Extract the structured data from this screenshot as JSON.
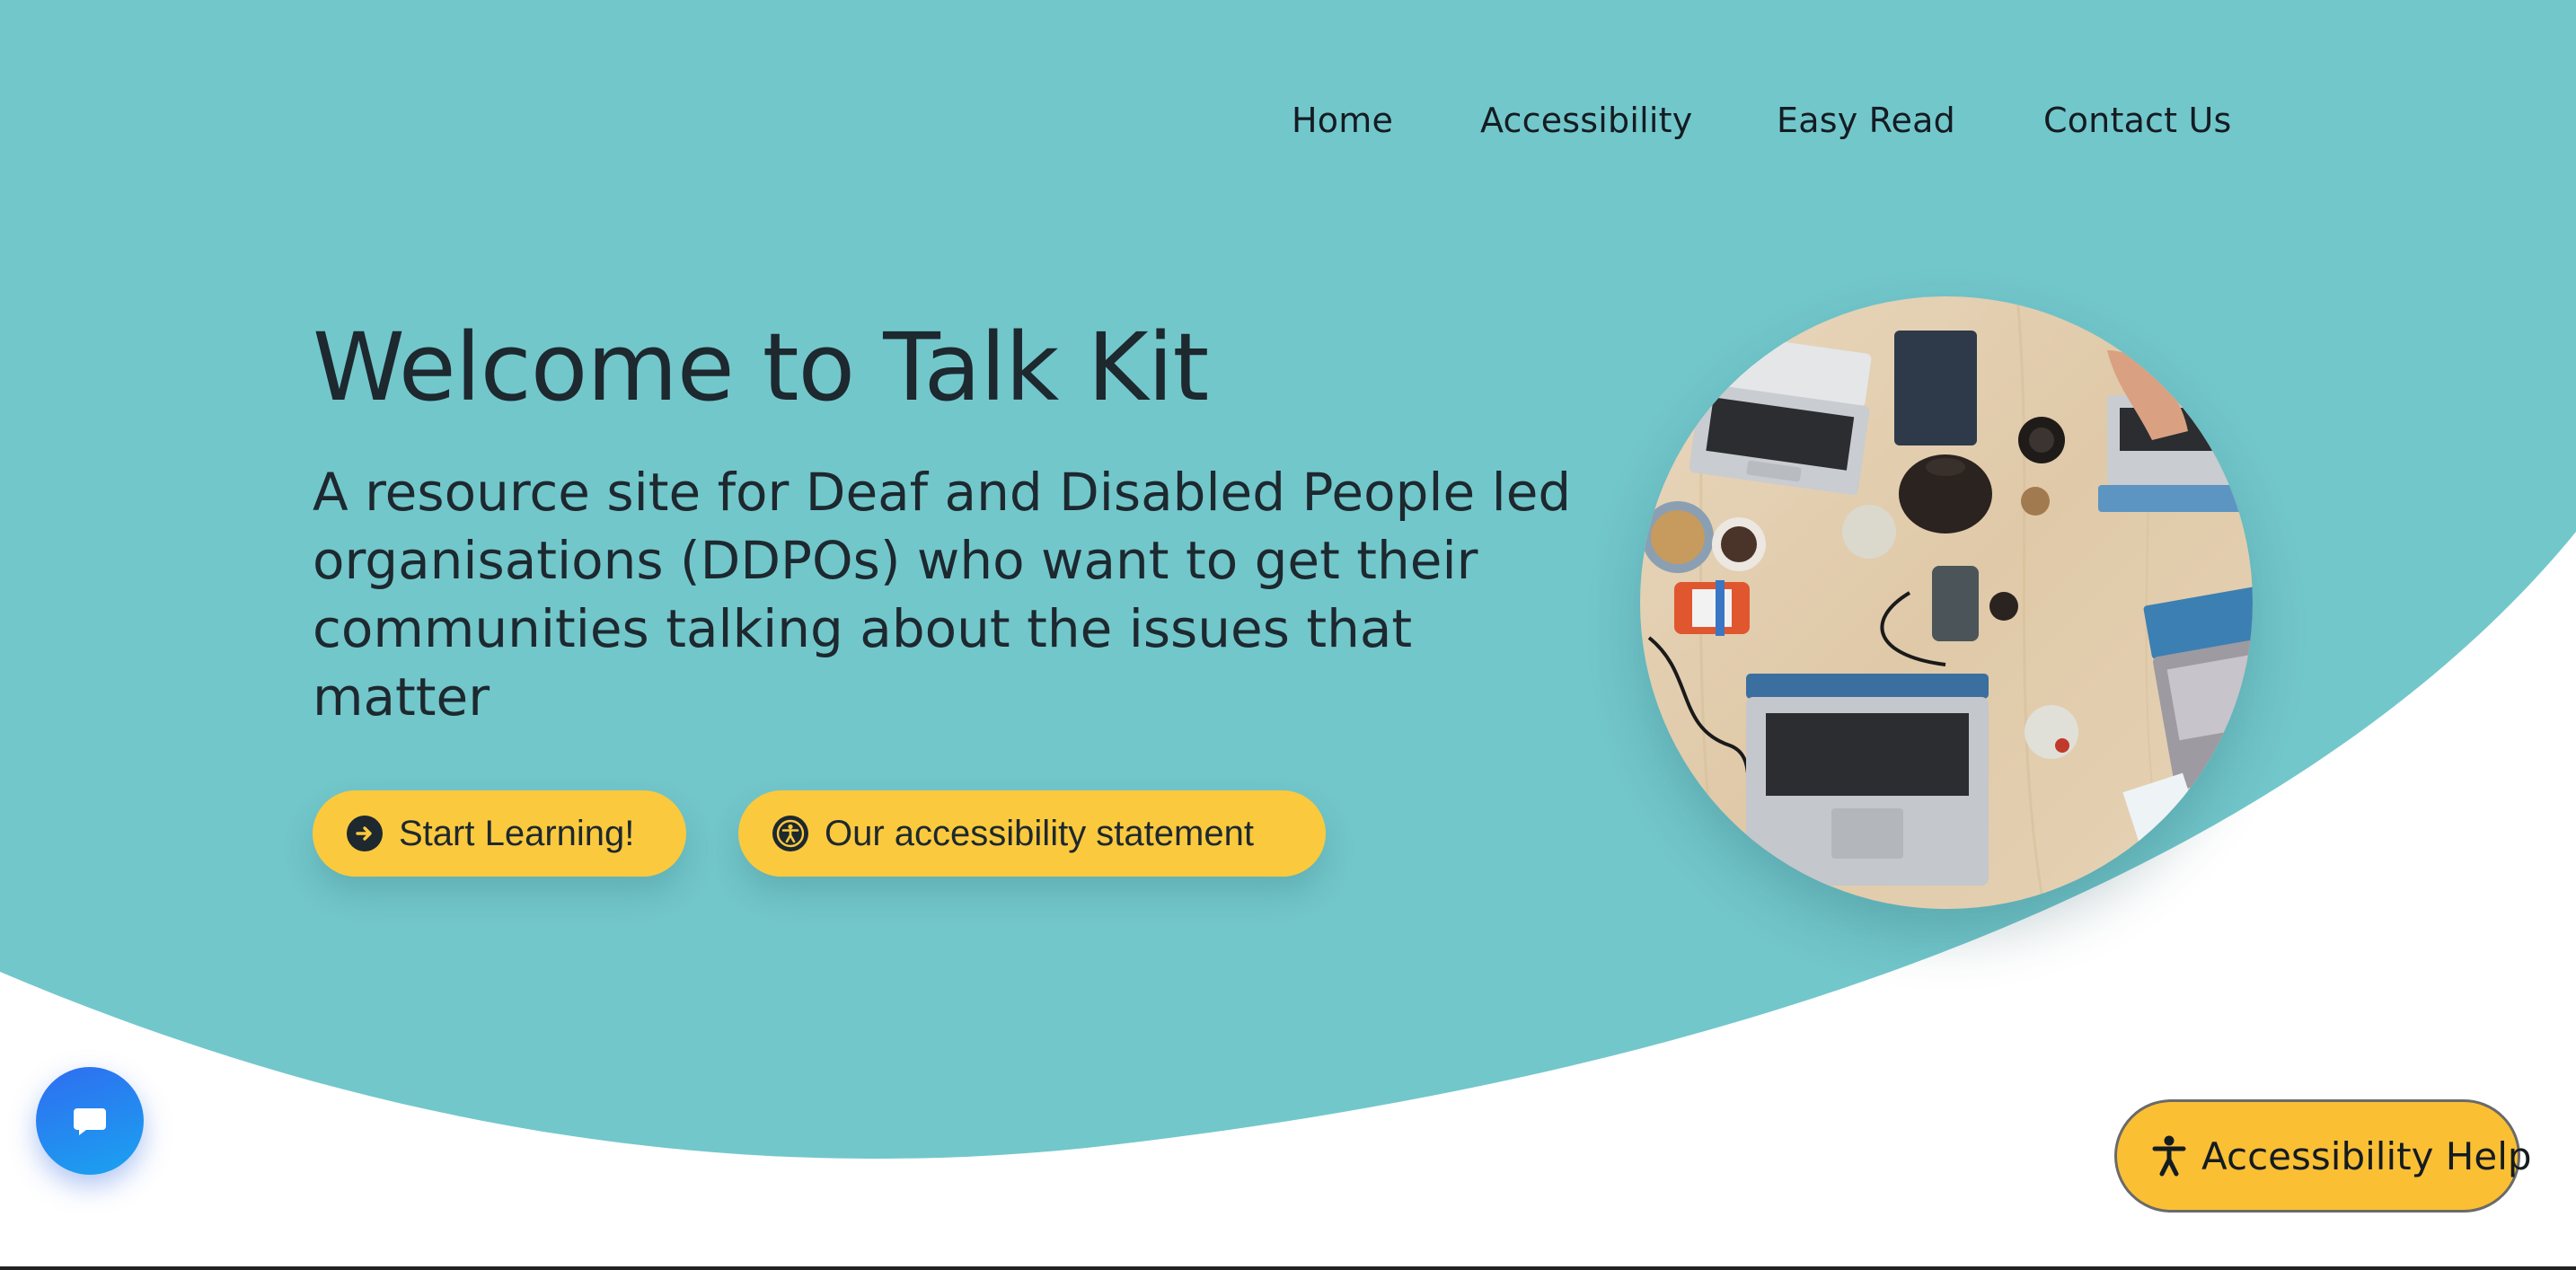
{
  "colors": {
    "hero_background": "#72c7cb",
    "button_yellow": "#fbc93d",
    "help_yellow": "#fbbf34",
    "text_dark": "#1d282f",
    "chat_blue": "#2f6df0"
  },
  "nav": {
    "items": [
      {
        "label": "Home"
      },
      {
        "label": "Accessibility"
      },
      {
        "label": "Easy Read"
      },
      {
        "label": "Contact Us"
      }
    ]
  },
  "hero": {
    "title": "Welcome to Talk Kit",
    "subtitle": "A resource site for Deaf and Disabled People led organisations (DDPOs) who want to get their communities talking about the issues that matter",
    "buttons": [
      {
        "label": "Start Learning!",
        "icon": "arrow-right-circle-icon"
      },
      {
        "label": "Our accessibility statement",
        "icon": "universal-access-icon"
      }
    ],
    "image_icon": "laptops-on-table-photo"
  },
  "widgets": {
    "chat_icon": "chat-bubble-icon",
    "accessibility_help_label": "Accessibility Help",
    "accessibility_help_icon": "person-accessibility-icon"
  }
}
